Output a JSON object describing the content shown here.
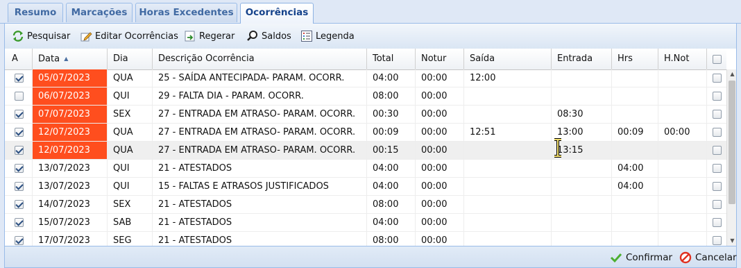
{
  "tabs": [
    "Resumo",
    "Marcações",
    "Horas Excedentes",
    "Ocorrências"
  ],
  "toolbar": {
    "pesquisar": "Pesquisar",
    "editar": "Editar Ocorrências",
    "regerar": "Regerar",
    "saldos": "Saldos",
    "legenda": "Legenda"
  },
  "columns": {
    "a": "A",
    "data": "Data",
    "dia": "Dia",
    "descricao": "Descrição Ocorrência",
    "total": "Total",
    "notur": "Notur",
    "saida": "Saída",
    "entrada": "Entrada",
    "hrs": "Hrs",
    "hnot": "H.Not"
  },
  "sort_indicator": "▲",
  "highlight_color": "#ff4e1e",
  "rows": [
    {
      "checked": true,
      "date": "05/07/2023",
      "highlight": true,
      "dia": "QUA",
      "desc": "25 - SAÍDA ANTECIPADA- PARAM. OCORR.",
      "total": "04:00",
      "notur": "00:00",
      "saida": "12:00",
      "entrada": "",
      "hrs": "",
      "hnot": ""
    },
    {
      "checked": false,
      "date": "06/07/2023",
      "highlight": true,
      "dia": "QUI",
      "desc": "29 - FALTA DIA - PARAM. OCORR.",
      "total": "08:00",
      "notur": "00:00",
      "saida": "",
      "entrada": "",
      "hrs": "",
      "hnot": ""
    },
    {
      "checked": true,
      "date": "07/07/2023",
      "highlight": true,
      "dia": "SEX",
      "desc": "27 - ENTRADA EM ATRASO- PARAM. OCORR.",
      "total": "00:30",
      "notur": "00:00",
      "saida": "",
      "entrada": "08:30",
      "hrs": "",
      "hnot": ""
    },
    {
      "checked": true,
      "date": "12/07/2023",
      "highlight": true,
      "dia": "QUA",
      "desc": "27 - ENTRADA EM ATRASO- PARAM. OCORR.",
      "total": "00:09",
      "notur": "00:00",
      "saida": "12:51",
      "entrada": "13:00",
      "hrs": "00:09",
      "hnot": "00:00"
    },
    {
      "checked": true,
      "date": "12/07/2023",
      "highlight": true,
      "dia": "QUA",
      "desc": "27 - ENTRADA EM ATRASO- PARAM. OCORR.",
      "total": "00:15",
      "notur": "00:00",
      "saida": "",
      "entrada": "13:15",
      "hrs": "",
      "hnot": "",
      "selected": true
    },
    {
      "checked": true,
      "date": "13/07/2023",
      "highlight": false,
      "dia": "QUI",
      "desc": "21 - ATESTADOS",
      "total": "04:00",
      "notur": "00:00",
      "saida": "",
      "entrada": "",
      "hrs": "04:00",
      "hnot": ""
    },
    {
      "checked": true,
      "date": "13/07/2023",
      "highlight": false,
      "dia": "QUI",
      "desc": "15 - FALTAS E ATRASOS JUSTIFICADOS",
      "total": "04:00",
      "notur": "00:00",
      "saida": "",
      "entrada": "",
      "hrs": "04:00",
      "hnot": ""
    },
    {
      "checked": true,
      "date": "14/07/2023",
      "highlight": false,
      "dia": "SEX",
      "desc": "21 - ATESTADOS",
      "total": "08:00",
      "notur": "00:00",
      "saida": "",
      "entrada": "",
      "hrs": "",
      "hnot": ""
    },
    {
      "checked": true,
      "date": "15/07/2023",
      "highlight": false,
      "dia": "SAB",
      "desc": "21 - ATESTADOS",
      "total": "04:00",
      "notur": "00:00",
      "saida": "",
      "entrada": "",
      "hrs": "",
      "hnot": ""
    },
    {
      "checked": true,
      "date": "17/07/2023",
      "highlight": false,
      "dia": "SEG",
      "desc": "21 - ATESTADOS",
      "total": "08:00",
      "notur": "00:00",
      "saida": "",
      "entrada": "",
      "hrs": "",
      "hnot": ""
    }
  ],
  "footer": {
    "confirmar": "Confirmar",
    "cancelar": "Cancelar"
  },
  "icons": {
    "pesquisar": "refresh-arrows-icon",
    "editar": "edit-pencil-icon",
    "regerar": "regenerate-icon",
    "saldos": "magnifier-icon",
    "legenda": "list-legend-icon",
    "confirmar": "green-check-icon",
    "cancelar": "red-cancel-icon"
  }
}
